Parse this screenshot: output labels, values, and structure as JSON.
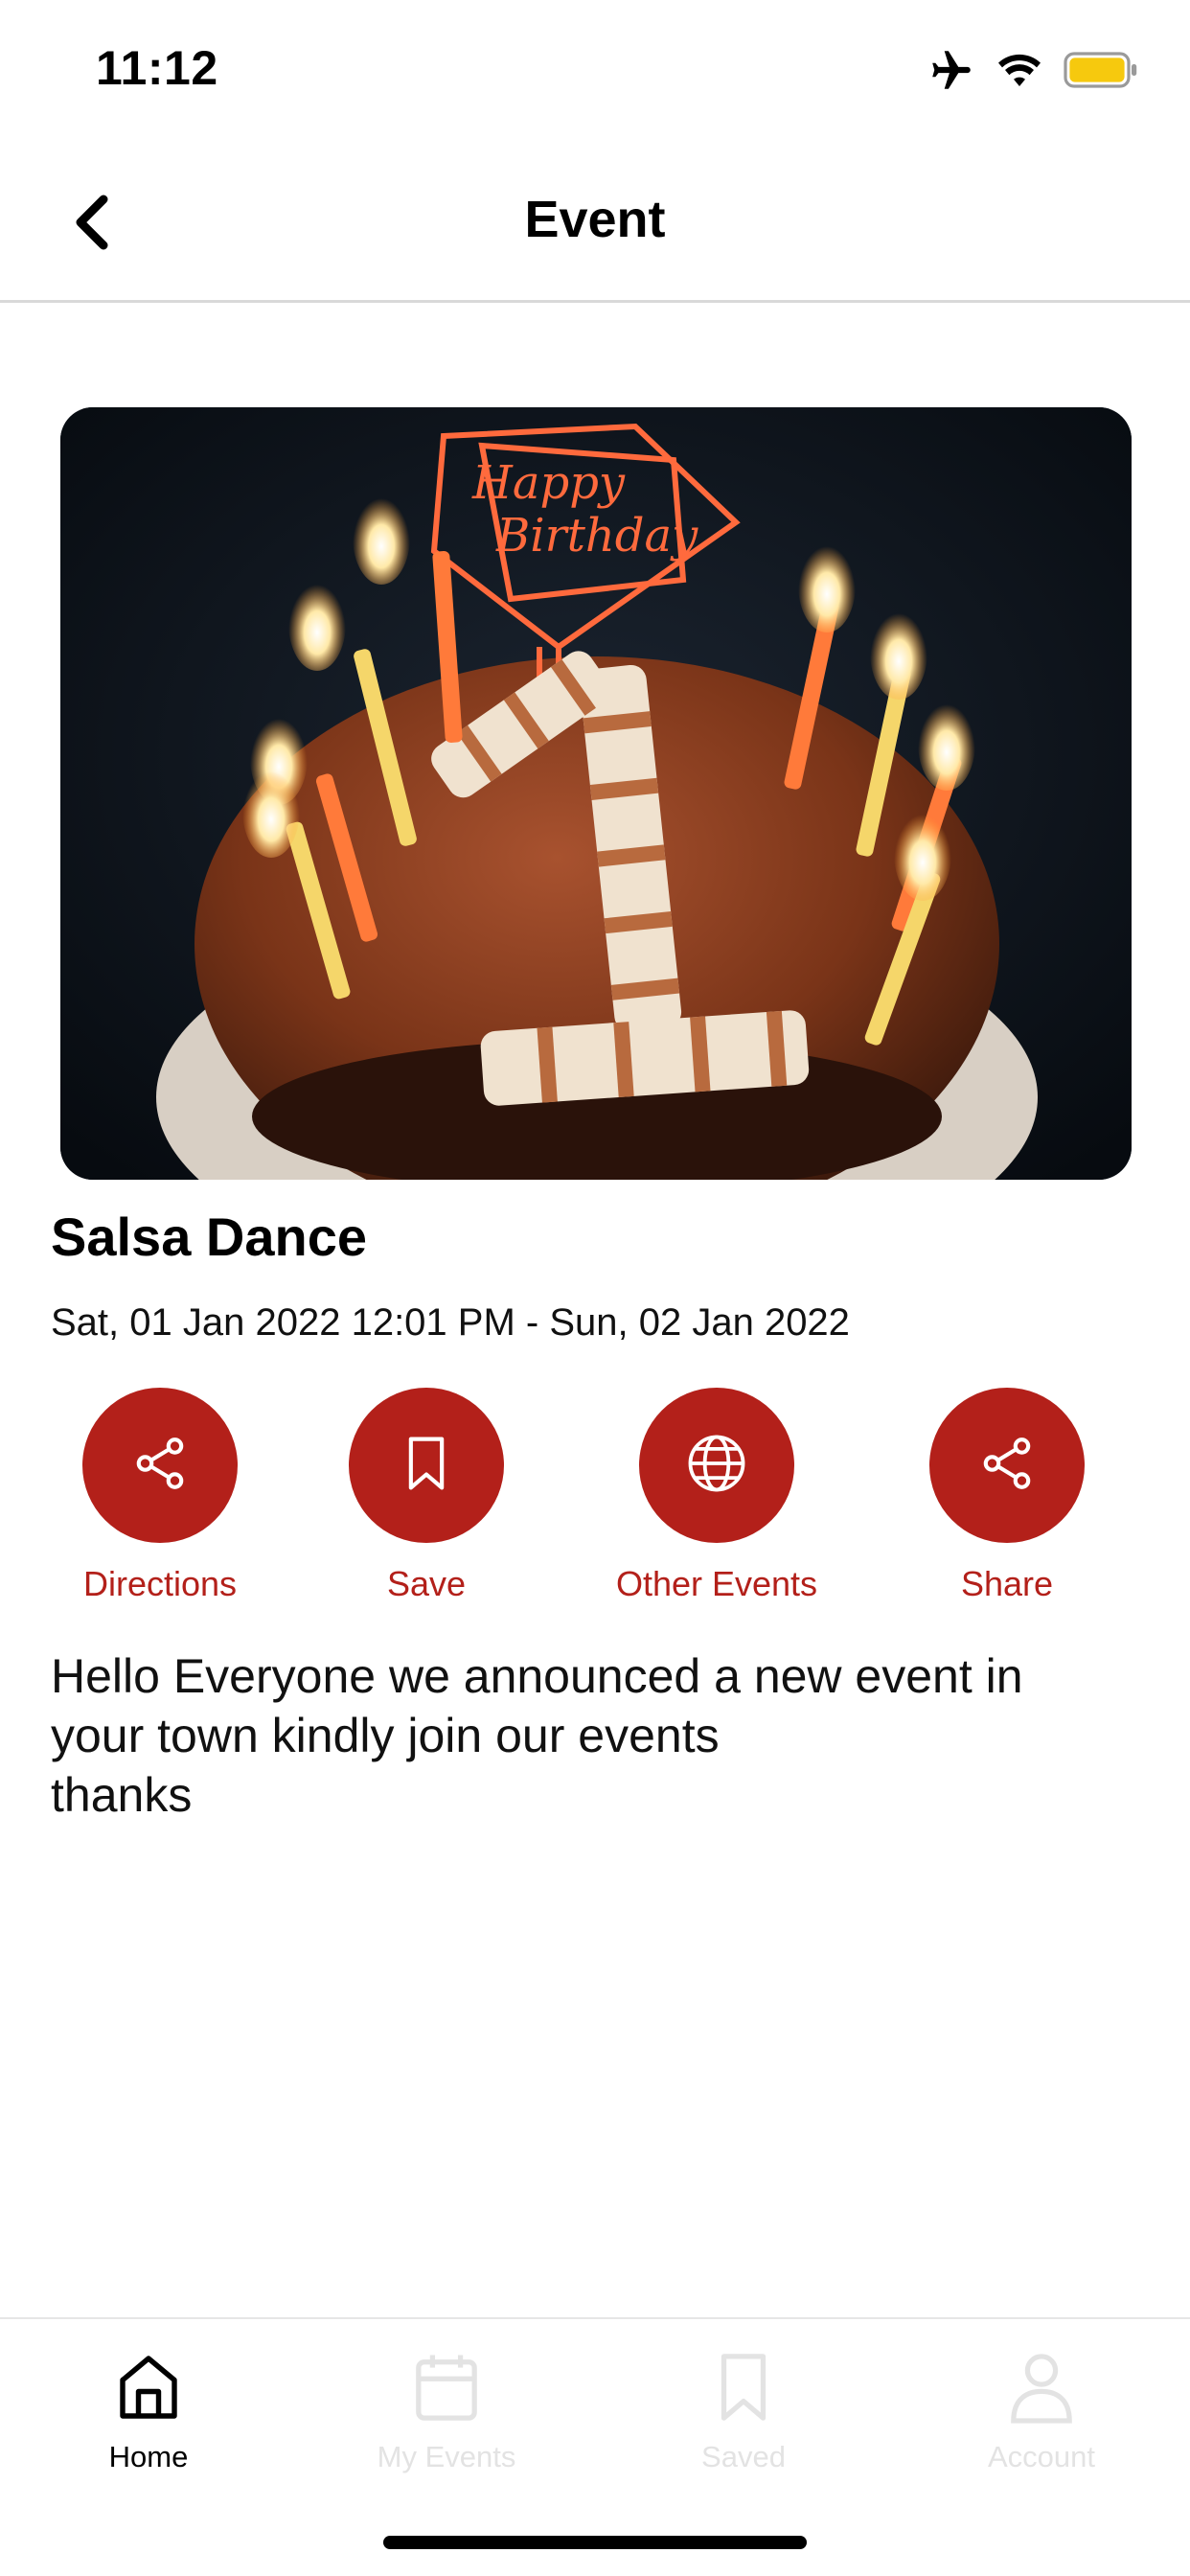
{
  "status_bar": {
    "time": "11:12",
    "icons": [
      "airplane-icon",
      "wifi-icon",
      "battery-icon"
    ],
    "battery_color": "#f6c90e"
  },
  "header": {
    "title": "Event",
    "back_icon": "chevron-left-icon"
  },
  "event": {
    "image_subject": "happy-birthday-cake-photo",
    "title": "Salsa Dance",
    "dates": "Sat, 01 Jan 2022 12:01 PM - Sun, 02 Jan 2022",
    "description": "Hello Everyone we announced a new event in\nyour town kindly join our events\nthanks"
  },
  "actions": [
    {
      "label": "Directions",
      "icon": "share-nodes-icon"
    },
    {
      "label": "Save",
      "icon": "bookmark-icon"
    },
    {
      "label": "Other Events",
      "icon": "globe-icon"
    },
    {
      "label": "Share",
      "icon": "share-nodes-icon"
    }
  ],
  "tabs": [
    {
      "label": "Home",
      "icon": "home-icon",
      "active": true
    },
    {
      "label": "My Events",
      "icon": "calendar-icon",
      "active": false
    },
    {
      "label": "Saved",
      "icon": "bookmark-icon",
      "active": false
    },
    {
      "label": "Account",
      "icon": "user-icon",
      "active": false
    }
  ],
  "colors": {
    "accent": "#b3201a",
    "tab_inactive": "#e3e3e3",
    "divider": "#d9d9d9"
  }
}
